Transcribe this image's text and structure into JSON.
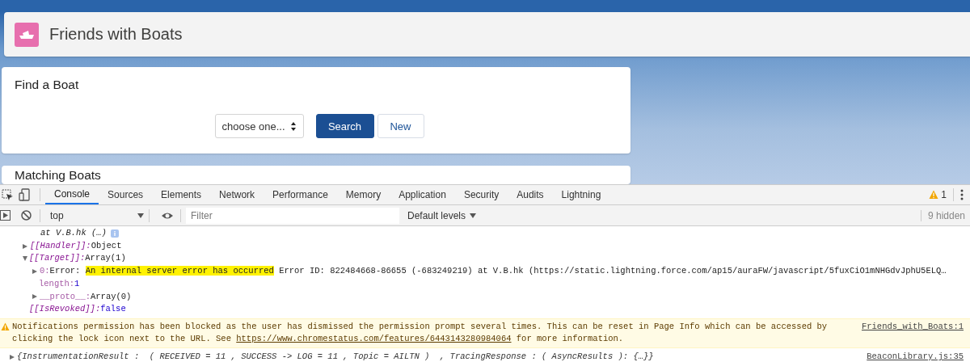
{
  "app": {
    "title": "Friends with Boats",
    "cards": [
      {
        "title": "Find a Boat",
        "select": {
          "value": "choose one..."
        },
        "buttons": [
          {
            "label": "Search",
            "kind": "brand"
          },
          {
            "label": "New",
            "kind": "neutral"
          }
        ]
      },
      {
        "title": "Matching Boats"
      }
    ]
  },
  "devtools": {
    "tabs": [
      {
        "label": "Console",
        "selected": true
      },
      {
        "label": "Sources",
        "selected": false
      },
      {
        "label": "Elements",
        "selected": false
      },
      {
        "label": "Network",
        "selected": false
      },
      {
        "label": "Performance",
        "selected": false
      },
      {
        "label": "Memory",
        "selected": false
      },
      {
        "label": "Application",
        "selected": false
      },
      {
        "label": "Security",
        "selected": false
      },
      {
        "label": "Audits",
        "selected": false
      },
      {
        "label": "Lightning",
        "selected": false
      }
    ],
    "warning_count": "1",
    "context": "top",
    "filter": {
      "placeholder": "Filter"
    },
    "levels": "Default levels",
    "hidden": "9 hidden",
    "entries": [
      {
        "kind": "trace",
        "text": "at V.B.hk (…)"
      },
      {
        "kind": "prop",
        "key": "[[Handler]]:",
        "value": {
          "kind": "plain",
          "text": "Object"
        },
        "expanded": false
      },
      {
        "kind": "prop",
        "key": "[[Target]]:",
        "value": {
          "kind": "plain",
          "text": "Array(1)"
        },
        "expanded": true,
        "children": [
          {
            "kind": "prop",
            "key": "0:",
            "value": {
              "kind": "plain",
              "text": "Error: ",
              "highlighted": "An internal server error has occurred",
              "text_after": " Error ID: 822484668-86655 (-683249219) at V.B.hk (https://static.lightning.force.com/ap15/auraFW/javascript/5fuxCiO1mNHGdvJphU5ELQ…"
            },
            "expanded": false
          },
          {
            "kind": "prop",
            "key": "length:",
            "value": {
              "kind": "number",
              "text": "1"
            }
          },
          {
            "kind": "prop",
            "key": "__proto__:",
            "value": {
              "kind": "plain",
              "text": "Array(0)"
            },
            "expanded": false
          }
        ]
      },
      {
        "kind": "prop",
        "key": "[[IsRevoked]]:",
        "value": {
          "kind": "boolean",
          "text": "false"
        }
      },
      {
        "kind": "warning",
        "text": "Notifications permission has been blocked as the user has dismissed the permission prompt several times. This can be reset in Page Info which can be accessed by clicking the lock icon next to the URL. See ",
        "link": "https://www.chromestatus.com/features/6443143280984064",
        "text_after": " for more information.",
        "source": "Friends_with_Boats:1"
      },
      {
        "kind": "log",
        "text": "{InstrumentationResult :  ( RECEIVED = 11 , SUCCESS -> LOG = 11 , Topic = AILTN )  , TracingResponse : ( AsyncResults ): {…}}",
        "source": "BeaconLibrary.js:35",
        "expanded": false
      }
    ]
  }
}
